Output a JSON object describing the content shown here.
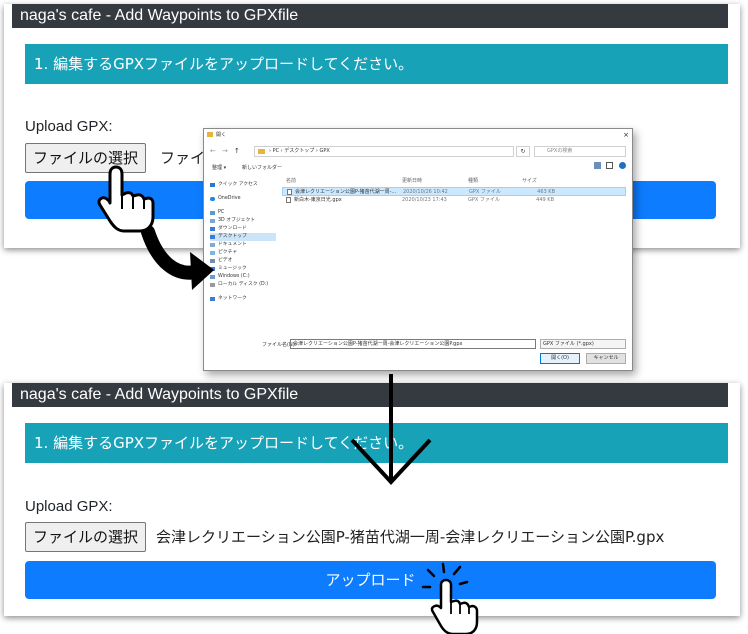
{
  "app": {
    "navbar_title": "naga's cafe - Add Waypoints to GPXfile",
    "section_title": "1. 編集するGPXファイルをアップロードしてください。",
    "upload_label": "Upload GPX:",
    "file_button": "ファイルの選択",
    "upload_button": "アップロード"
  },
  "top_state": {
    "file_name_partial": "ファイ"
  },
  "bottom_state": {
    "file_name": "会津レクリエーション公園P-猪苗代湖一周-会津レクリエーション公園P.gpx"
  },
  "dialog": {
    "title": "開く",
    "close_glyph": "×",
    "address": "›  PC  ›  デスクトップ  ›  GPX",
    "search_placeholder": "GPXの検索",
    "toolbar": {
      "organize": "整理 ▾",
      "new_folder": "新しいフォルダー"
    },
    "tree": [
      {
        "label": "クイック アクセス",
        "icon_color": "#2b78d4"
      },
      {
        "label": "OneDrive",
        "icon_color": "#1e88e5"
      },
      {
        "label": "PC",
        "icon_color": "#5a9bd4"
      },
      {
        "label": "3D オブジェクト",
        "icon_color": "#7aa6d8"
      },
      {
        "label": "ダウンロード",
        "icon_color": "#3a7bd5"
      },
      {
        "label": "デスクトップ",
        "icon_color": "#3a7bd5"
      },
      {
        "label": "ドキュメント",
        "icon_color": "#8aa9c8"
      },
      {
        "label": "ピクチャ",
        "icon_color": "#7fb3e0"
      },
      {
        "label": "ビデオ",
        "icon_color": "#6f8fb5"
      },
      {
        "label": "ミュージック",
        "icon_color": "#3a7bd5"
      },
      {
        "label": "Windows (C:)",
        "icon_color": "#6a9bd1"
      },
      {
        "label": "ローカル ディスク (D:)",
        "icon_color": "#9a9a9a"
      },
      {
        "label": "ネットワーク",
        "icon_color": "#3a7bd5"
      }
    ],
    "columns": {
      "name": "名前",
      "date": "更新日時",
      "type": "種類",
      "size": "サイズ"
    },
    "files": [
      {
        "name": "会津レクリエーション公園P-猪苗代湖一周-...",
        "date": "2020/10/26 10:42",
        "type": "GPX ファイル",
        "size": "463 KB"
      },
      {
        "name": "新白木-東京日光.gpx",
        "date": "2020/10/23 17:43",
        "type": "GPX ファイル",
        "size": "449 KB"
      }
    ],
    "filename_label": "ファイル名(N):",
    "filename_value": "会津レクリエーション公園P-猪苗代湖一周-会津レクリエーション公園P.gpx",
    "filetype": "GPX ファイル (*.gpx)",
    "open_button": "開く(O)",
    "cancel_button": "キャンセル"
  }
}
